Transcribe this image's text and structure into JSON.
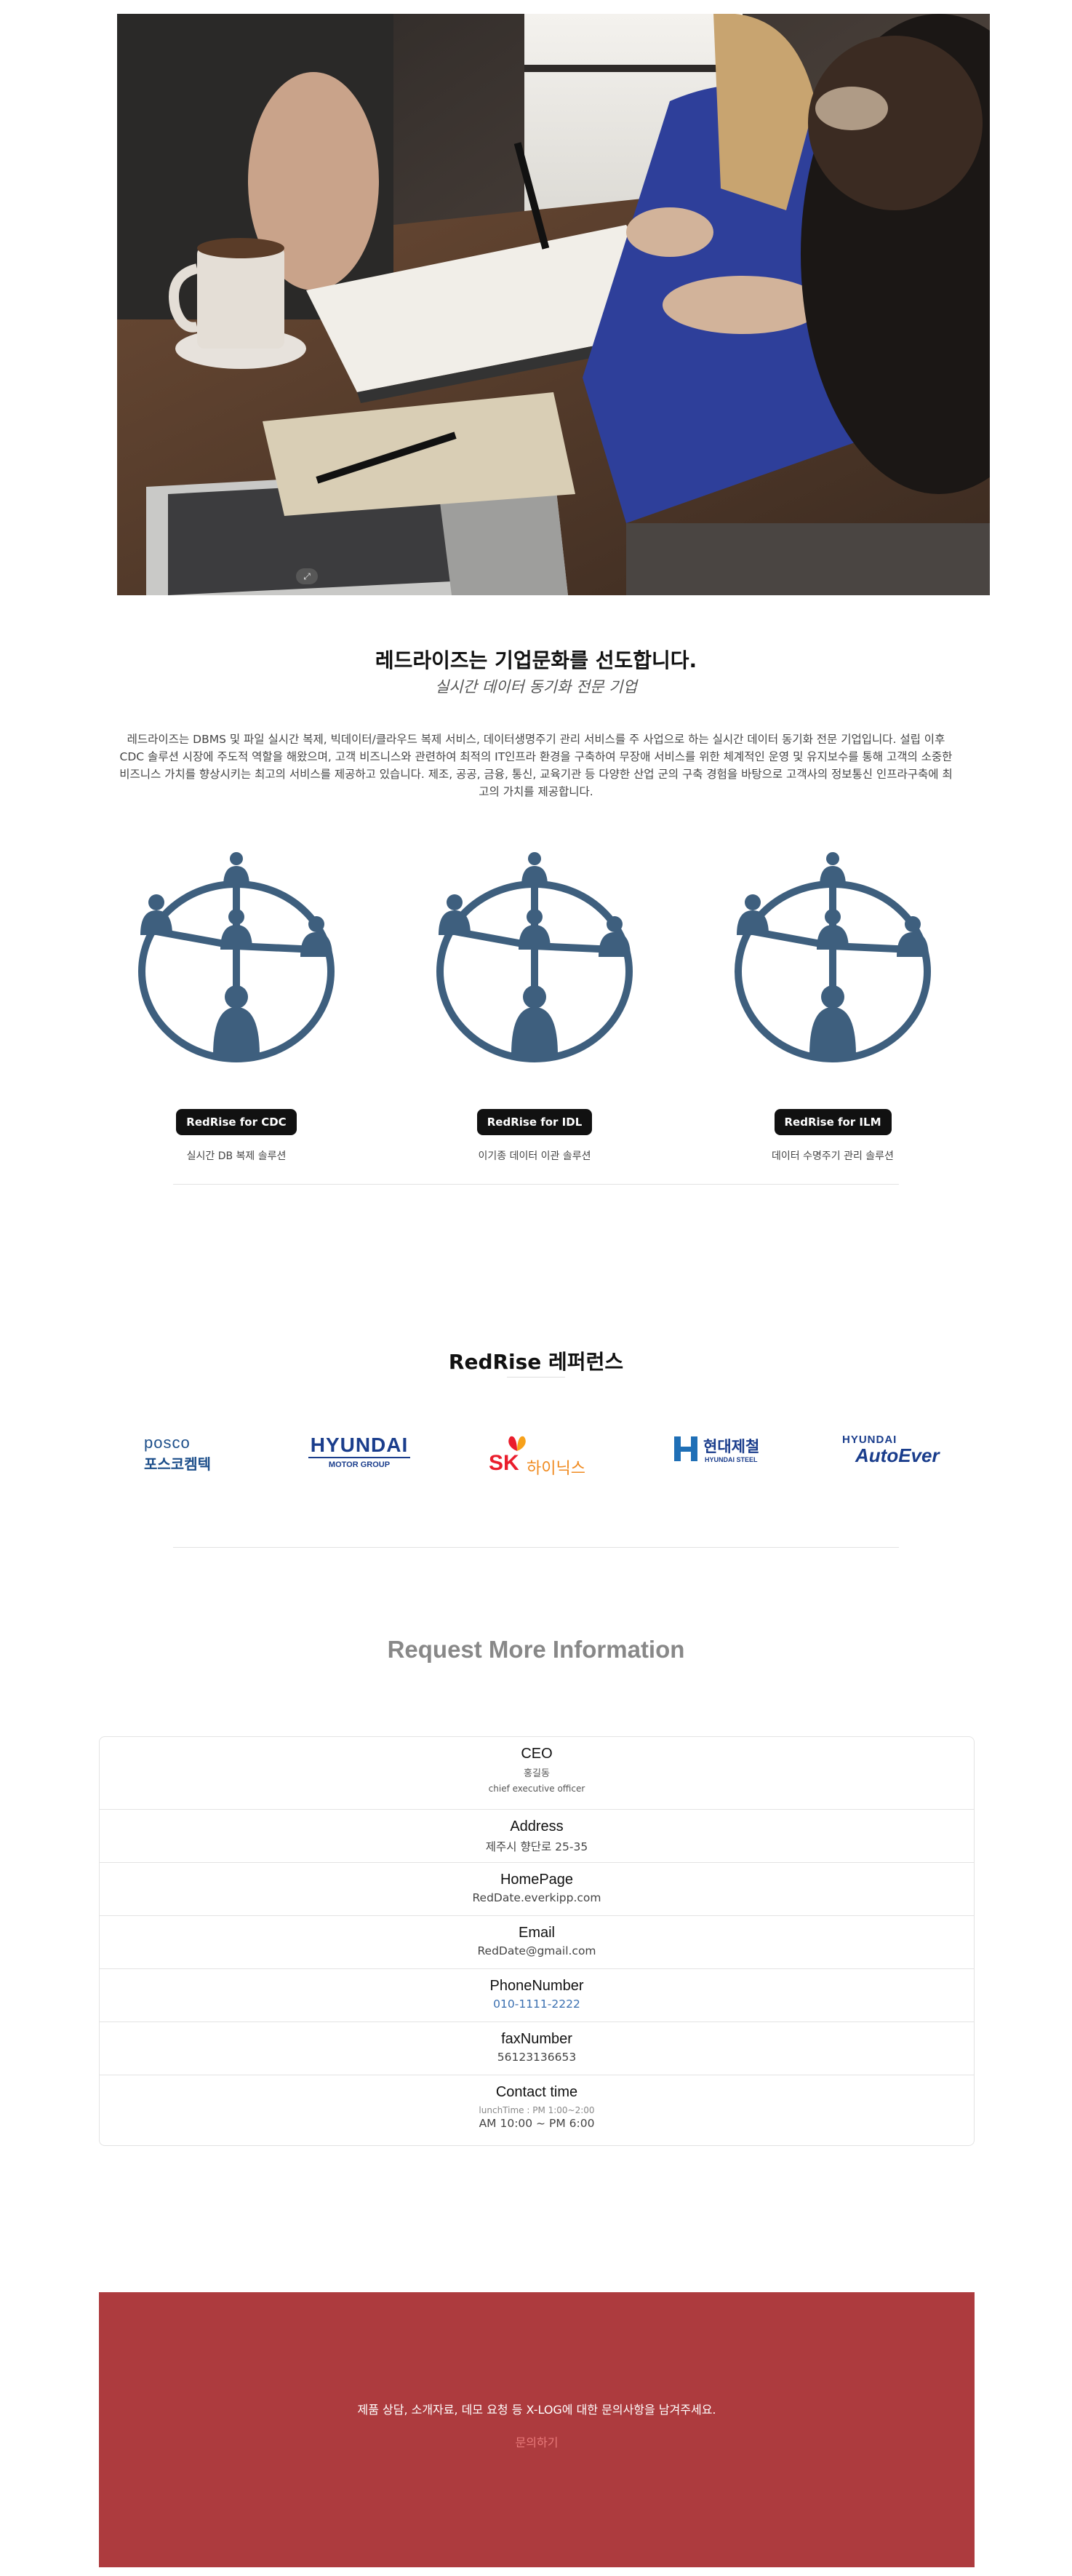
{
  "hero": {
    "badge_icon": "expand-icon"
  },
  "intro": {
    "title": "레드라이즈는 기업문화를 선도합니다.",
    "subtitle": "실시간 데이터 동기화 전문 기업",
    "body": "레드라이즈는 DBMS 및 파일 실시간 복제, 빅데이터/클라우드 복제 서비스, 데이터생명주기 관리 서비스를 주 사업으로 하는 실시간 데이터 동기화 전문 기업입니다. 설립 이후 CDC 솔루션 시장에 주도적 역할을 해왔으며, 고객 비즈니스와 관련하여 최적의 IT인프라 환경을 구축하여 무장애 서비스를 위한 체계적인 운영 및 유지보수를 통해 고객의 소중한 비즈니스 가치를 향상시키는 최고의 서비스를 제공하고 있습니다. 제조, 공공, 금융, 통신, 교육기관 등 다양한 산업 군의 구축 경험을 바탕으로 고객사의 정보통신 인프라구축에 최고의 가치를 제공합니다."
  },
  "products": [
    {
      "button": "RedRise for CDC",
      "desc": "실시간 DB 복제 솔루션",
      "icon": "network-people-icon"
    },
    {
      "button": "RedRise for IDL",
      "desc": "이기종 데이터 이관 솔루션",
      "icon": "network-people-icon"
    },
    {
      "button": "RedRise for ILM",
      "desc": "데이터 수명주기 관리 솔루션",
      "icon": "network-people-icon"
    }
  ],
  "references": {
    "title": "RedRise 레퍼런스",
    "logos": {
      "posco_top": "posco",
      "posco_bottom": "포스코켐텍",
      "hyundai_motor_top": "HYUNDAI",
      "hyundai_motor_bottom": "MOTOR GROUP",
      "sk_mark": "SK",
      "sk_text": "하이닉스",
      "hsteel_text": "현대제철",
      "hsteel_sub": "HYUNDAI STEEL",
      "autoever_top": "HYUNDAI",
      "autoever_bottom": "AutoEver"
    }
  },
  "request": {
    "title": "Request More Information",
    "rows": {
      "ceo_label": "CEO",
      "ceo_name": "홍길동",
      "ceo_role": "chief executive officer",
      "address_label": "Address",
      "address_value": "제주시 향단로 25-35",
      "homepage_label": "HomePage",
      "homepage_value": "RedDate.everkipp.com",
      "email_label": "Email",
      "email_value": "RedDate@gmail.com",
      "phone_label": "PhoneNumber",
      "phone_value": "010-1111-2222",
      "fax_label": "faxNumber",
      "fax_value": "56123136653",
      "contact_label": "Contact time",
      "contact_lunch": "lunchTime : PM 1:00~2:00",
      "contact_hours": "AM 10:00 ~ PM 6:00"
    }
  },
  "band": {
    "text": "제품 상담, 소개자료, 데모 요청 등 X-LOG에 대한 문의사항을 남겨주세요.",
    "link": "문의하기"
  },
  "colors": {
    "band": "#ad3b3e",
    "icon": "#3e5f7e",
    "link": "#3a6fb0"
  }
}
